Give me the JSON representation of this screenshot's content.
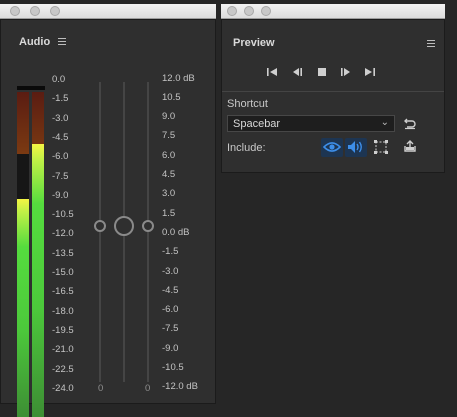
{
  "audio_window": {
    "title": "Audio",
    "meter": {
      "left_level": 0.67,
      "right_level": 0.84
    },
    "db_scale_left": [
      "0.0",
      "-1.5",
      "-3.0",
      "-4.5",
      "-6.0",
      "-7.5",
      "-9.0",
      "-10.5",
      "-12.0",
      "-13.5",
      "-15.0",
      "-16.5",
      "-18.0",
      "-19.5",
      "-21.0",
      "-22.5",
      "-24.0"
    ],
    "db_scale_right": [
      "12.0 dB",
      "10.5",
      "9.0",
      "7.5",
      "6.0",
      "4.5",
      "3.0",
      "1.5",
      "0.0 dB",
      "-1.5",
      "-3.0",
      "-4.5",
      "-6.0",
      "-7.5",
      "-9.0",
      "-10.5",
      "-12.0 dB"
    ],
    "fader_left_zero": "0",
    "fader_right_zero": "0"
  },
  "preview_window": {
    "title": "Preview",
    "transport": {
      "first": "first-frame-icon",
      "prev": "previous-frame-icon",
      "stop": "stop-icon",
      "next": "next-frame-icon",
      "last": "last-frame-icon"
    },
    "shortcut_label": "Shortcut",
    "shortcut_value": "Spacebar",
    "include_label": "Include:",
    "include_icons": [
      "video-eye-icon",
      "audio-speaker-icon",
      "overlays-bounding-box-icon"
    ],
    "reset_icon": "reset-icon",
    "export_icon": "export-icon"
  },
  "colors": {
    "panel": "#2f2f2f",
    "background": "#262626",
    "accent_blue": "#3d8ee8",
    "meter_green": "#4cc83b",
    "meter_yellow": "#f4f544"
  }
}
